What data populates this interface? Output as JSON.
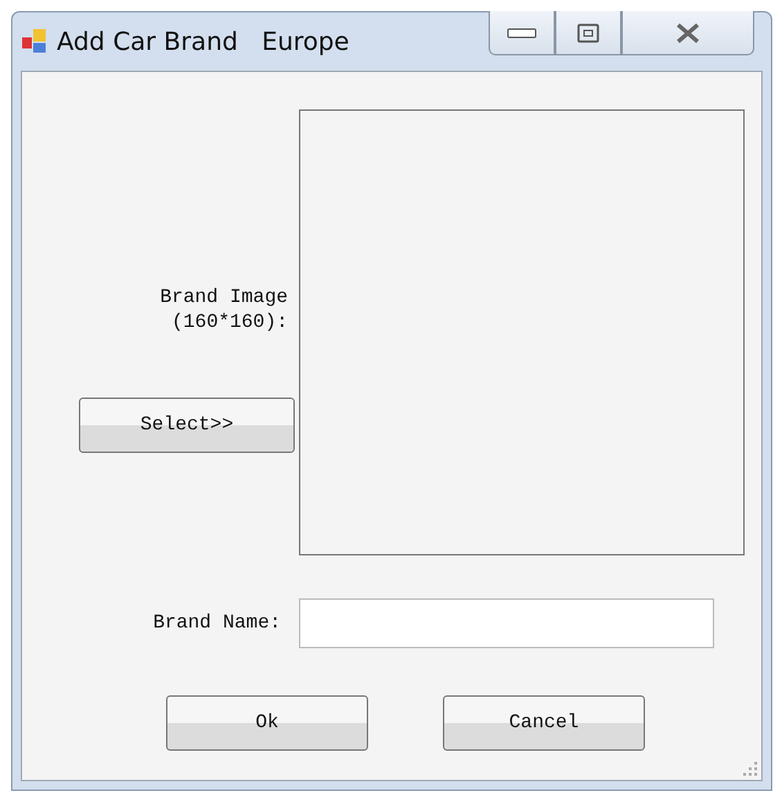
{
  "window": {
    "title": "Add Car Brand   Europe"
  },
  "brand_image": {
    "label": "Brand Image\n(160*160):",
    "button": "Select>>"
  },
  "brand_name": {
    "label": "Brand Name:"
  },
  "buttons": [
    {
      "label": "Ok"
    },
    {
      "label": "Cancel"
    }
  ]
}
